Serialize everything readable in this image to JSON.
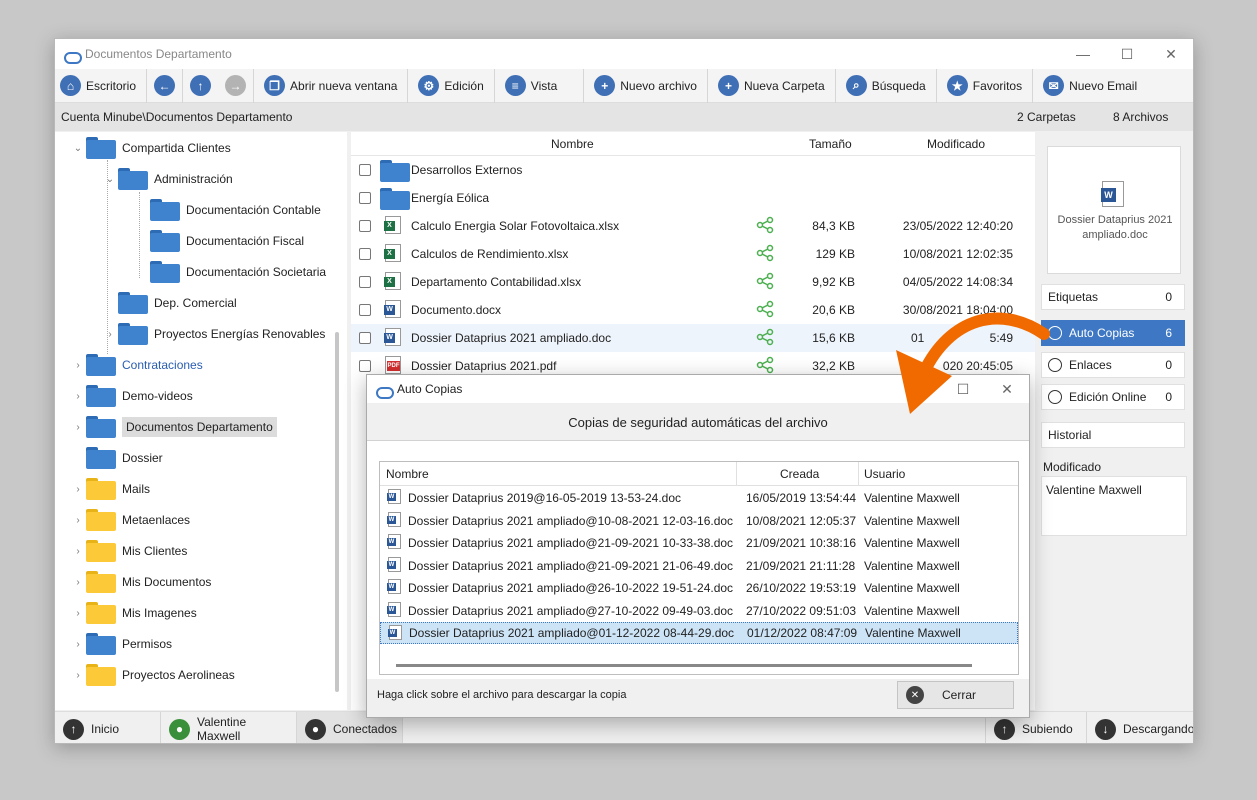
{
  "window": {
    "title": "Documentos Departamento",
    "controls": {
      "minimize": "—",
      "maximize": "☐",
      "close": "✕"
    }
  },
  "toolbar": {
    "escritorio": "Escritorio",
    "abrir": "Abrir nueva ventana",
    "edicion": "Edición",
    "vista": "Vista",
    "nuevo_archivo": "Nuevo archivo",
    "nueva_carpeta": "Nueva Carpeta",
    "busqueda": "Búsqueda",
    "favoritos": "Favoritos",
    "nuevo_email": "Nuevo Email"
  },
  "path": {
    "location": "Cuenta Minube\\Documentos Departamento",
    "carpetas": "2 Carpetas",
    "archivos": "8 Archivos"
  },
  "tree": [
    {
      "label": "Compartida Clientes",
      "color": "blue",
      "arrow": "⌄"
    },
    {
      "label": "Administración",
      "color": "blue",
      "arrow": "⌄"
    },
    {
      "label": "Documentación Contable",
      "color": "blue",
      "arrow": ""
    },
    {
      "label": "Documentación Fiscal",
      "color": "blue",
      "arrow": ""
    },
    {
      "label": "Documentación Societaria",
      "color": "blue",
      "arrow": ""
    },
    {
      "label": "Dep. Comercial",
      "color": "blue",
      "arrow": ""
    },
    {
      "label": "Proyectos Energías Renovables",
      "color": "blue",
      "arrow": "›"
    },
    {
      "label": "Contrataciones",
      "color": "blue",
      "arrow": "›",
      "link_color": "#2a5db0"
    },
    {
      "label": "Demo-videos",
      "color": "blue",
      "arrow": "›"
    },
    {
      "label": "Documentos Departamento",
      "color": "blue",
      "arrow": "›",
      "selected": true
    },
    {
      "label": "Dossier",
      "color": "blue",
      "arrow": ""
    },
    {
      "label": "Mails",
      "color": "yellow",
      "arrow": "›"
    },
    {
      "label": "Metaenlaces",
      "color": "yellow",
      "arrow": "›"
    },
    {
      "label": "Mis Clientes",
      "color": "yellow",
      "arrow": "›"
    },
    {
      "label": "Mis Documentos",
      "color": "yellow",
      "arrow": "›"
    },
    {
      "label": "Mis Imagenes",
      "color": "yellow",
      "arrow": "›"
    },
    {
      "label": "Permisos",
      "color": "blue",
      "arrow": "›"
    },
    {
      "label": "Proyectos Aerolineas",
      "color": "yellow",
      "arrow": "›"
    }
  ],
  "filelist": {
    "headers": {
      "name": "Nombre",
      "size": "Tamaño",
      "modified": "Modificado"
    },
    "rows": [
      {
        "name": "Desarrollos Externos",
        "type": "folder",
        "size": "",
        "modified": ""
      },
      {
        "name": "Energía Eólica",
        "type": "folder",
        "size": "",
        "modified": ""
      },
      {
        "name": "Calculo Energia Solar Fotovoltaica.xlsx",
        "type": "excel",
        "size": "84,3 KB",
        "modified": "23/05/2022 12:40:20"
      },
      {
        "name": "Calculos de Rendimiento.xlsx",
        "type": "excel",
        "size": "129 KB",
        "modified": "10/08/2021 12:02:35"
      },
      {
        "name": "Departamento Contabilidad.xlsx",
        "type": "excel",
        "size": "9,92 KB",
        "modified": "04/05/2022 14:08:34"
      },
      {
        "name": "Documento.docx",
        "type": "word",
        "size": "20,6 KB",
        "modified": "30/08/2021 18:04:00"
      },
      {
        "name": "Dossier Dataprius 2021 ampliado.doc",
        "type": "word",
        "size": "15,6 KB",
        "modified": "01",
        "extra": "5:49"
      },
      {
        "name": "Dossier Dataprius 2021.pdf",
        "type": "pdf",
        "size": "32,2 KB",
        "modified": "020 20:45:05"
      }
    ]
  },
  "sidebar": {
    "preview_name": "Dossier Dataprius 2021 ampliado.doc",
    "etiquetas": "Etiquetas",
    "etiquetas_count": "0",
    "auto_copias": "Auto Copias",
    "auto_copias_count": "6",
    "enlaces": "Enlaces",
    "enlaces_count": "0",
    "edicion_online": "Edición Online",
    "edicion_online_count": "0",
    "historial": "Historial",
    "modificado_label": "Modificado",
    "modificado_by": "Valentine Maxwell"
  },
  "statusbar": {
    "inicio": "Inicio",
    "user": "Valentine Maxwell",
    "conectados": "Conectados",
    "subiendo": "Subiendo",
    "descargando": "Descargando"
  },
  "dialog": {
    "title": "Auto Copias",
    "heading": "Copias de seguridad automáticas del archivo",
    "headers": {
      "name": "Nombre",
      "created": "Creada",
      "user": "Usuario"
    },
    "rows": [
      {
        "name": "Dossier Dataprius 2019@16-05-2019 13-53-24.doc",
        "created": "16/05/2019 13:54:44",
        "user": "Valentine Maxwell"
      },
      {
        "name": "Dossier Dataprius 2021 ampliado@10-08-2021 12-03-16.doc",
        "created": "10/08/2021 12:05:37",
        "user": "Valentine Maxwell"
      },
      {
        "name": "Dossier Dataprius 2021 ampliado@21-09-2021 10-33-38.doc",
        "created": "21/09/2021 10:38:16",
        "user": "Valentine Maxwell"
      },
      {
        "name": "Dossier Dataprius 2021 ampliado@21-09-2021 21-06-49.doc",
        "created": "21/09/2021 21:11:28",
        "user": "Valentine Maxwell"
      },
      {
        "name": "Dossier Dataprius 2021 ampliado@26-10-2022 19-51-24.doc",
        "created": "26/10/2022 19:53:19",
        "user": "Valentine Maxwell"
      },
      {
        "name": "Dossier Dataprius 2021 ampliado@27-10-2022 09-49-03.doc",
        "created": "27/10/2022 09:51:03",
        "user": "Valentine Maxwell"
      },
      {
        "name": "Dossier Dataprius 2021 ampliado@01-12-2022 08-44-29.doc",
        "created": "01/12/2022 08:47:09",
        "user": "Valentine Maxwell",
        "selected": true
      }
    ],
    "footer": "Haga click sobre el archivo para descargar la copia",
    "close_label": "Cerrar"
  },
  "colors": {
    "accent": "#3e78c4",
    "arrow": "#f06a00",
    "share": "#4caf50"
  }
}
